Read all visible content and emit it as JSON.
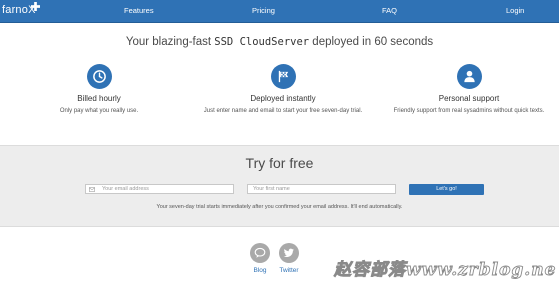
{
  "nav": {
    "logo": "farnoX",
    "links": [
      "Features",
      "Pricing",
      "FAQ",
      "Login"
    ]
  },
  "hero": {
    "headline_before": "Your blazing-fast ",
    "headline_mono": "SSD CloudServer",
    "headline_after": " deployed in 60 seconds"
  },
  "features": [
    {
      "icon": "clock-icon",
      "title": "Billed hourly",
      "text": "Only pay what you really use."
    },
    {
      "icon": "flag-icon",
      "title": "Deployed instantly",
      "text": "Just enter name and email to start your free seven-day trial."
    },
    {
      "icon": "person-icon",
      "title": "Personal support",
      "text": "Friendly support from real sysadmins without quick texts."
    }
  ],
  "trial": {
    "title": "Try for free",
    "email_placeholder": "Your email address",
    "name_placeholder": "Your first name",
    "button": "Let's go!",
    "note": "Your seven-day trial starts immediately after you confirmed your email address. It'll end automatically."
  },
  "social": [
    {
      "icon": "chat-bubble-icon",
      "label": "Blog"
    },
    {
      "icon": "twitter-bird-icon",
      "label": "Twitter"
    }
  ],
  "watermark": "赵容部落www.zrblog.net",
  "colors": {
    "brand": "#2f72b5",
    "band": "#ededed",
    "social_gray": "#a9a9a9"
  }
}
